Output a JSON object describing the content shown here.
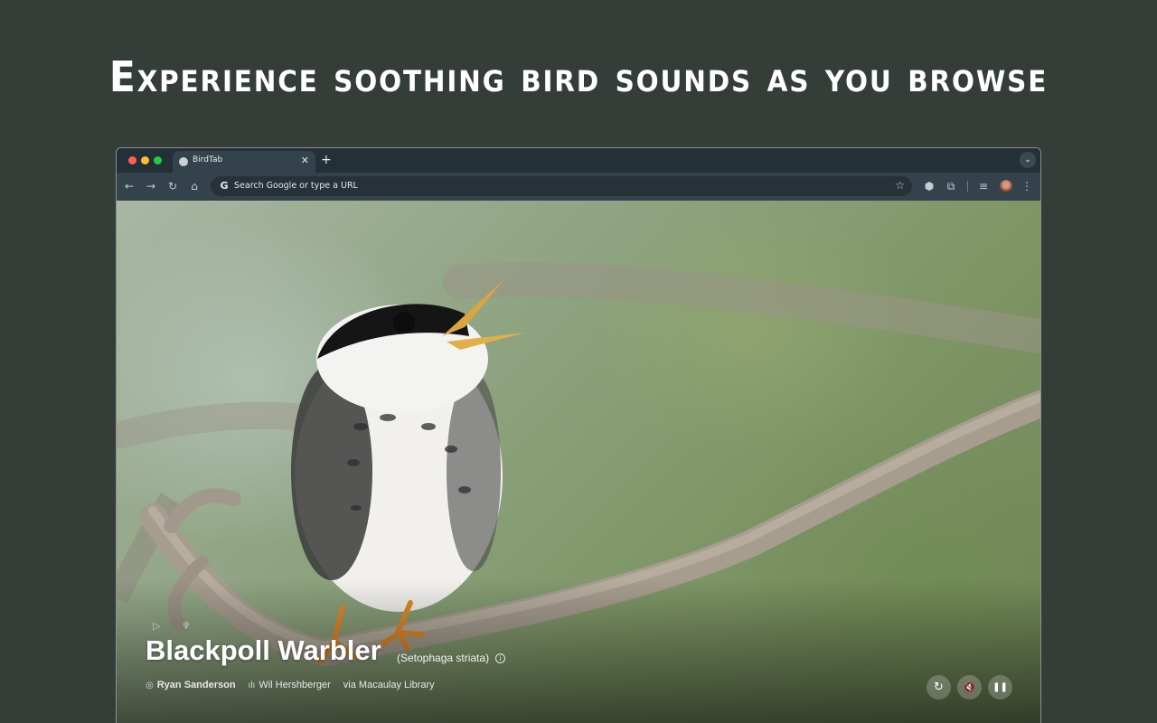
{
  "headline": "Experience soothing bird sounds as you browse",
  "browser": {
    "tab": {
      "title": "BirdTab",
      "close": "✕"
    },
    "new_tab": "+",
    "tab_dropdown": "⌄",
    "toolbar": {
      "back": "←",
      "forward": "→",
      "reload": "↻",
      "home": "⌂",
      "omnibox_placeholder": "Search Google or type a URL",
      "google_glyph": "G",
      "star": "☆",
      "extension": "⬢",
      "puzzle": "⧉",
      "reading_list": "≡",
      "menu": "⋮"
    }
  },
  "bird": {
    "common_name": "Blackpoll Warbler",
    "scientific_name": "(Setophaga striata)",
    "info": "i",
    "photo_credit": "Ryan Sanderson",
    "audio_credit": "Wil Hershberger",
    "source": "via Macaulay Library"
  },
  "controls": {
    "refresh": "↻",
    "mute": "🔇",
    "pause": "❚❚"
  },
  "icons": {
    "camera": "◎",
    "audio": "ılı",
    "mini_play": "▷",
    "mini_bird": "♆"
  }
}
